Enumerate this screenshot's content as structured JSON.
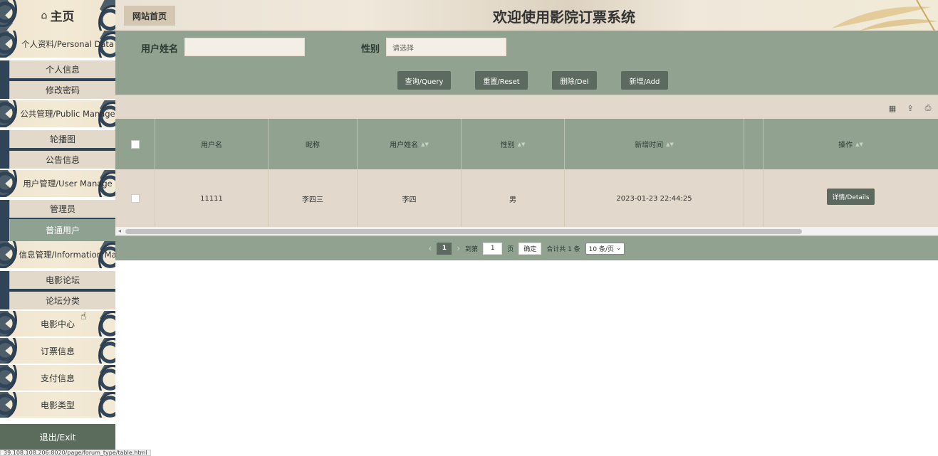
{
  "sidebar": {
    "home_label": "主页",
    "home_icon": "home-icon",
    "groups": [
      {
        "label": "个人资料/Personal Data",
        "items": [
          "个人信息",
          "修改密码"
        ]
      },
      {
        "label": "公共管理/Public Manage",
        "items": [
          "轮播图",
          "公告信息"
        ]
      },
      {
        "label": "用户管理/User Manage",
        "items": [
          "管理员",
          "普通用户"
        ]
      },
      {
        "label": "信息管理/Information Ma",
        "items": [
          "电影论坛",
          "论坛分类"
        ]
      }
    ],
    "singles": [
      "电影中心",
      "订票信息",
      "支付信息",
      "电影类型"
    ],
    "exit_label": "退出/Exit",
    "active_item": "普通用户"
  },
  "header": {
    "breadcrumb": "网站首页",
    "title": "欢迎使用影院订票系统"
  },
  "search": {
    "name_label": "用户姓名",
    "name_value": "",
    "gender_label": "性别",
    "gender_placeholder": "请选择",
    "buttons": {
      "query": "查询/Query",
      "reset": "重置/Reset",
      "delete": "删除/Del",
      "add": "新增/Add"
    }
  },
  "table": {
    "columns": [
      "用户名",
      "昵称",
      "用户姓名",
      "性别",
      "新增时间",
      "",
      "操作"
    ],
    "rows": [
      {
        "username": "11111",
        "nickname": "李四三",
        "realname": "李四",
        "gender": "男",
        "created": "2023-01-23 22:44:25",
        "action": "详情/Details"
      }
    ]
  },
  "pager": {
    "current": "1",
    "goto_prefix": "到第",
    "goto_value": "1",
    "goto_suffix": "页",
    "confirm": "确定",
    "total": "合计共 1 条",
    "per_page": "10 条/页"
  },
  "status_bar": "39.108.108.206:8020/page/forum_type/table.html",
  "colors": {
    "sage": "#91a390",
    "dark_button": "#5c6a60",
    "beige": "#e2d9cc",
    "navy_wave": "#2f4457"
  }
}
